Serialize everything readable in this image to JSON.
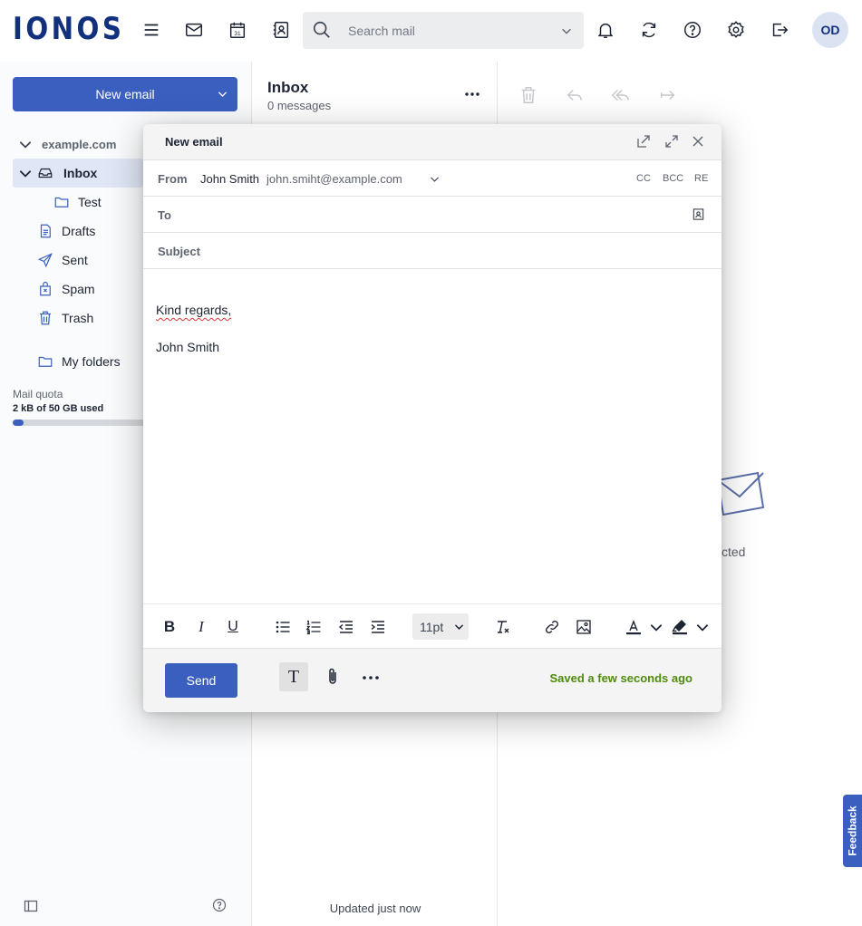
{
  "brand": {
    "logo_text": "IONOS",
    "accent": "#3a5fbf",
    "logo_color": "#11307e"
  },
  "topbar": {
    "icons": [
      "menu-icon",
      "mail-icon",
      "calendar-icon",
      "contacts-icon",
      "notification-bell-icon",
      "sync-icon",
      "help-icon",
      "settings-icon",
      "logout-icon"
    ],
    "calendar_day": "31",
    "search": {
      "placeholder": "Search mail"
    },
    "avatar_initials": "OD"
  },
  "sidebar": {
    "new_email_label": "New email",
    "domain": "example.com",
    "folders": [
      {
        "label": "Inbox",
        "icon": "inbox-icon"
      },
      {
        "label": "Test",
        "icon": "folder-icon"
      },
      {
        "label": "Drafts",
        "icon": "drafts-icon"
      },
      {
        "label": "Sent",
        "icon": "sent-icon"
      },
      {
        "label": "Spam",
        "icon": "spam-icon"
      },
      {
        "label": "Trash",
        "icon": "trash-icon"
      },
      {
        "label": "My folders",
        "icon": "folder-icon"
      }
    ],
    "quota_label": "Mail quota",
    "quota_value": "2 kB of 50 GB used",
    "quota_fill_percent": 5
  },
  "maillist": {
    "title": "Inbox",
    "count": "0 messages",
    "updated": "Updated just now"
  },
  "pane": {
    "empty_text_visible": "cted"
  },
  "feedback_label": "Feedback",
  "compose": {
    "title": "New email",
    "from_label": "From",
    "from_name": "John Smith",
    "from_address": "john.smiht@example.com",
    "cc": "CC",
    "bcc": "BCC",
    "re": "RE",
    "to_label": "To",
    "subject_label": "Subject",
    "body_regards": "Kind regards,",
    "body_signature": "John Smith",
    "font_size": "11pt",
    "send_label": "Send",
    "saved_status": "Saved a few seconds ago",
    "saved_color": "#4f8a10"
  }
}
